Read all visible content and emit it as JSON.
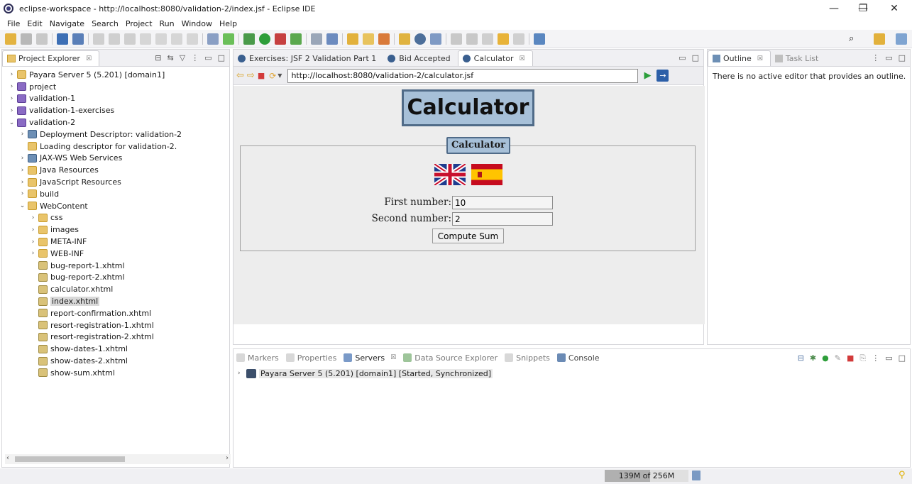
{
  "window": {
    "title": "eclipse-workspace - http://localhost:8080/validation-2/index.jsf - Eclipse IDE",
    "minimize": "—",
    "restore": "❐",
    "close": "✕"
  },
  "menu": [
    "File",
    "Edit",
    "Navigate",
    "Search",
    "Project",
    "Run",
    "Window",
    "Help"
  ],
  "project_explorer": {
    "tab_label": "Project Explorer",
    "close": "☒",
    "items": [
      {
        "label": "Payara Server 5 (5.201) [domain1]",
        "arrow": "›",
        "icon": "folder"
      },
      {
        "label": "project",
        "arrow": "›",
        "icon": "project"
      },
      {
        "label": "validation-1",
        "arrow": "›",
        "icon": "project"
      },
      {
        "label": "validation-1-exercises",
        "arrow": "›",
        "icon": "project"
      },
      {
        "label": "validation-2",
        "arrow": "⌄",
        "icon": "project"
      },
      {
        "label": "Deployment Descriptor: validation-2",
        "arrow": "›",
        "icon": "gear"
      },
      {
        "label": "Loading descriptor for validation-2.",
        "arrow": "",
        "icon": "folder"
      },
      {
        "label": "JAX-WS Web Services",
        "arrow": "›",
        "icon": "gear"
      },
      {
        "label": "Java Resources",
        "arrow": "›",
        "icon": "folder"
      },
      {
        "label": "JavaScript Resources",
        "arrow": "›",
        "icon": "folder"
      },
      {
        "label": "build",
        "arrow": "›",
        "icon": "folder"
      },
      {
        "label": "WebContent",
        "arrow": "⌄",
        "icon": "folder"
      },
      {
        "label": "css",
        "arrow": "›",
        "icon": "folder"
      },
      {
        "label": "images",
        "arrow": "›",
        "icon": "folder"
      },
      {
        "label": "META-INF",
        "arrow": "›",
        "icon": "folder"
      },
      {
        "label": "WEB-INF",
        "arrow": "›",
        "icon": "folder"
      },
      {
        "label": "bug-report-1.xhtml",
        "arrow": "",
        "icon": "xhtml"
      },
      {
        "label": "bug-report-2.xhtml",
        "arrow": "",
        "icon": "xhtml"
      },
      {
        "label": "calculator.xhtml",
        "arrow": "",
        "icon": "xhtml"
      },
      {
        "label": "index.xhtml",
        "arrow": "",
        "icon": "xhtml",
        "selected": true
      },
      {
        "label": "report-confirmation.xhtml",
        "arrow": "",
        "icon": "xhtml"
      },
      {
        "label": "resort-registration-1.xhtml",
        "arrow": "",
        "icon": "xhtml"
      },
      {
        "label": "resort-registration-2.xhtml",
        "arrow": "",
        "icon": "xhtml"
      },
      {
        "label": "show-dates-1.xhtml",
        "arrow": "",
        "icon": "xhtml"
      },
      {
        "label": "show-dates-2.xhtml",
        "arrow": "",
        "icon": "xhtml"
      },
      {
        "label": "show-sum.xhtml",
        "arrow": "",
        "icon": "xhtml"
      }
    ]
  },
  "editor_tabs": [
    {
      "label": "Exercises: JSF 2 Validation Part 1",
      "active": false
    },
    {
      "label": "Bid Accepted",
      "active": false
    },
    {
      "label": "Calculator",
      "active": true
    }
  ],
  "browser": {
    "url": "http://localhost:8080/validation-2/calculator.jsf",
    "page": {
      "title": "Calculator",
      "legend": "Calculator",
      "first_label": "First number:",
      "first_value": "10",
      "second_label": "Second number:",
      "second_value": "2",
      "compute_label": "Compute Sum"
    }
  },
  "outline": {
    "tab_label": "Outline",
    "task_tab_label": "Task List",
    "message": "There is no active editor that provides an outline."
  },
  "bottom_panel": {
    "tabs": [
      {
        "label": "Markers",
        "active": false
      },
      {
        "label": "Properties",
        "active": false
      },
      {
        "label": "Servers",
        "active": true
      },
      {
        "label": "Data Source Explorer",
        "active": false
      },
      {
        "label": "Snippets",
        "active": false
      },
      {
        "label": "Console",
        "active": false
      }
    ],
    "server_row": "Payara Server 5 (5.201) [domain1]  [Started, Synchronized]"
  },
  "status": {
    "memory_text": "139M of 256M",
    "memory_used_fraction": 0.543
  },
  "colors": {
    "page_background": "#ededed",
    "title_box": "#a7c0d8",
    "title_border": "#506b88"
  }
}
